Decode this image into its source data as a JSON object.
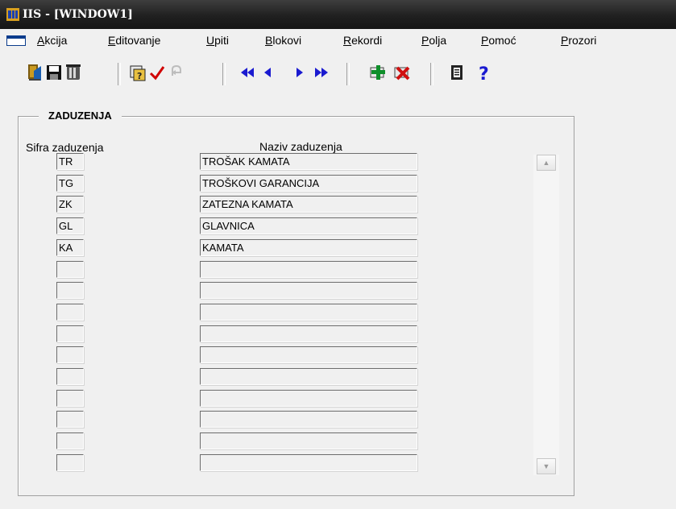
{
  "window": {
    "title": "IIS - [WINDOW1]"
  },
  "menu": [
    {
      "label": "Akcija",
      "key": "A",
      "rest": "kcija"
    },
    {
      "label": "Editovanje",
      "key": "E",
      "rest": "ditovanje"
    },
    {
      "label": "Upiti",
      "key": "U",
      "rest": "piti"
    },
    {
      "label": "Blokovi",
      "key": "B",
      "rest": "lokovi"
    },
    {
      "label": "Rekordi",
      "key": "R",
      "rest": "ekordi"
    },
    {
      "label": "Polja",
      "key": "P",
      "rest": "olja"
    },
    {
      "label": "Pomoć",
      "key": "P",
      "rest": "omoć"
    },
    {
      "label": "Prozori",
      "key": "P",
      "rest": "rozori"
    }
  ],
  "toolbar": {
    "icons": [
      "exit-icon",
      "save-icon",
      "print-icon",
      "enter-query-icon",
      "execute-query-icon",
      "cancel-query-icon",
      "first-record-icon",
      "previous-record-icon",
      "next-record-icon",
      "last-record-icon",
      "insert-record-icon",
      "delete-record-icon",
      "list-of-values-icon",
      "help-icon"
    ],
    "colors": {
      "navigation": "#1a1ad0",
      "insert": "#0e8f2a",
      "delete": "#d01010",
      "check": "#d00000"
    }
  },
  "block": {
    "title": "ZADUZENJA",
    "col_code_header": "Sifra zaduzenja",
    "col_name_header": "Naziv zaduzenja",
    "rows": [
      {
        "code": "TR",
        "name": "TROŠAK KAMATA"
      },
      {
        "code": "TG",
        "name": "TROŠKOVI GARANCIJA"
      },
      {
        "code": "ZK",
        "name": "ZATEZNA KAMATA"
      },
      {
        "code": "GL",
        "name": "GLAVNICA"
      },
      {
        "code": "KA",
        "name": "KAMATA"
      },
      {
        "code": "",
        "name": ""
      },
      {
        "code": "",
        "name": ""
      },
      {
        "code": "",
        "name": ""
      },
      {
        "code": "",
        "name": ""
      },
      {
        "code": "",
        "name": ""
      },
      {
        "code": "",
        "name": ""
      },
      {
        "code": "",
        "name": ""
      },
      {
        "code": "",
        "name": ""
      },
      {
        "code": "",
        "name": ""
      },
      {
        "code": "",
        "name": ""
      }
    ]
  }
}
